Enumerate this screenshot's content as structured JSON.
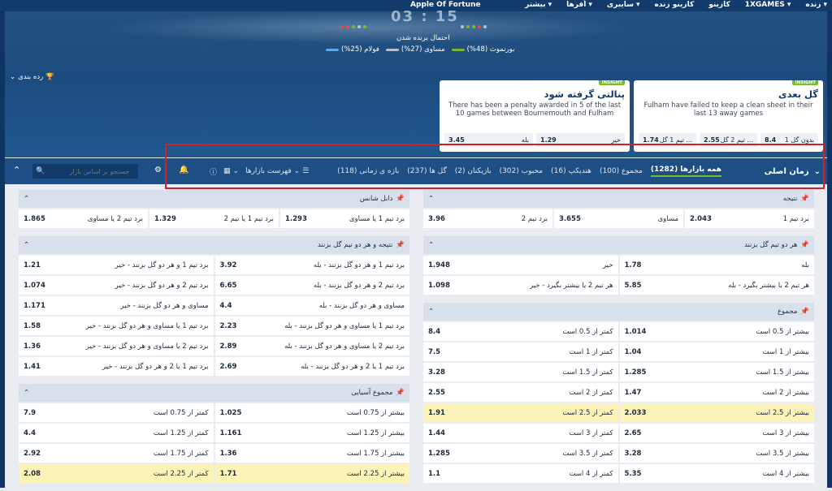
{
  "topnav": {
    "brand": "Apple Of Fortune",
    "items": [
      "زنده",
      "1XGAMES",
      "کازینو",
      "کازینو زنده",
      "سایبری",
      "اُفرها",
      "بیشتر"
    ]
  },
  "hero": {
    "score": "03 : 15",
    "prob_title": "احتمال برنده شدن",
    "bournemouth": "بورنموث (48%)",
    "draw": "مساوی (27%)",
    "fulham": "فولام (25%)",
    "ranking": "رده بندی",
    "colors": {
      "green": "#7bb92f",
      "grey": "#b8c2cf",
      "blue": "#5da8e6"
    }
  },
  "insights": [
    {
      "tag": "INSIGHT",
      "title": "گل بعدی",
      "desc": "Fulham have failed to keep a clean sheet in their last 13 away games",
      "odds": [
        {
          "label": "تیم 1 گل ...",
          "val": "1.74"
        },
        {
          "label": "تیم 2 گل ...",
          "val": "2.55"
        },
        {
          "label": "بدون گل 1",
          "val": "8.4"
        }
      ]
    },
    {
      "tag": "INSIGHT",
      "title": "پنالتی گرفته شود",
      "desc": "There has been a penalty awarded in 5 of the last 10 games between Bournemouth and Fulham",
      "odds": [
        {
          "label": "بله",
          "val": "3.45"
        },
        {
          "label": "خیر",
          "val": "1.29"
        }
      ]
    }
  ],
  "filter": {
    "main": "زمان اصلی",
    "cats": [
      {
        "label": "همه بازارها (1282)"
      },
      {
        "label": "مجموع (100)"
      },
      {
        "label": "هندیکپ (16)"
      },
      {
        "label": "محبوب (302)"
      },
      {
        "label": "بازیکنان (2)"
      },
      {
        "label": "گل ها (237)"
      },
      {
        "label": "بازه ی زمانی (118)"
      }
    ],
    "list_label": "فهرست بازارها",
    "search_placeholder": "جستجو بر اساس بازار"
  },
  "markets": {
    "result": {
      "title": "نتیجه",
      "cells": [
        {
          "l": "برد تیم 1",
          "o": "2.043"
        },
        {
          "l": "مساوی",
          "o": "3.655"
        },
        {
          "l": "برد تیم 2",
          "o": "3.96"
        }
      ]
    },
    "btts": {
      "title": "هر دو تیم گل بزنند",
      "cells": [
        {
          "l": "بله",
          "o": "1.78"
        },
        {
          "l": "خیر",
          "o": "1.948"
        },
        {
          "l": "هر تیم 2 یا بیشتر بگیرد - بله",
          "o": "5.85"
        },
        {
          "l": "هر تیم 2 یا بیشتر بگیرد - خیر",
          "o": "1.098"
        }
      ]
    },
    "total": {
      "title": "مجموع",
      "cells": [
        {
          "l": "بیشتر از 0.5 است",
          "o": "1.014"
        },
        {
          "l": "کمتر از 0.5 است",
          "o": "8.4"
        },
        {
          "l": "بیشتر از 1 است",
          "o": "1.04"
        },
        {
          "l": "کمتر از 1 است",
          "o": "7.5"
        },
        {
          "l": "بیشتر از 1.5 است",
          "o": "1.285"
        },
        {
          "l": "کمتر از 1.5 است",
          "o": "3.28"
        },
        {
          "l": "بیشتر از 2 است",
          "o": "1.47"
        },
        {
          "l": "کمتر از 2 است",
          "o": "2.55"
        },
        {
          "l": "بیشتر از 2.5 است",
          "o": "2.033",
          "hl": true
        },
        {
          "l": "کمتر از 2.5 است",
          "o": "1.91",
          "hl": true
        },
        {
          "l": "بیشتر از 3 است",
          "o": "2.65"
        },
        {
          "l": "کمتر از 3 است",
          "o": "1.44"
        },
        {
          "l": "بیشتر از 3.5 است",
          "o": "3.28"
        },
        {
          "l": "کمتر از 3.5 است",
          "o": "1.285"
        },
        {
          "l": "بیشتر از 4 است",
          "o": "5.35"
        },
        {
          "l": "کمتر از 4 است",
          "o": "1.1"
        }
      ]
    },
    "double": {
      "title": "دابل شانس",
      "cells": [
        {
          "l": "برد تیم 1 یا مساوی",
          "o": "1.293"
        },
        {
          "l": "برد تیم 1 یا تیم 2",
          "o": "1.329"
        },
        {
          "l": "برد تیم 2 یا مساوی",
          "o": "1.865"
        }
      ]
    },
    "result_btts": {
      "title": "نتیجه و هر دو تیم گل بزنند",
      "cells": [
        {
          "l": "برد تیم 1 و هر دو گل بزنند - بله",
          "o": "3.92"
        },
        {
          "l": "برد تیم 1 و هر دو گل بزنند - خیر",
          "o": "1.21"
        },
        {
          "l": "برد تیم 2 و هر دو گل بزنند - بله",
          "o": "6.65"
        },
        {
          "l": "برد تیم 2 و هر دو گل بزنند - خیر",
          "o": "1.074"
        },
        {
          "l": "مساوی و هر دو گل بزنند - بله",
          "o": "4.4"
        },
        {
          "l": "مساوی و هر دو گل بزنند - خیر",
          "o": "1.171"
        },
        {
          "l": "برد تیم 1 یا مساوی و هر دو گل بزنند - بله",
          "o": "2.23"
        },
        {
          "l": "برد تیم 1 یا مساوی و هر دو گل بزنند - خیر",
          "o": "1.58"
        },
        {
          "l": "برد تیم 2 یا مساوی و هر دو گل بزنند - بله",
          "o": "2.89"
        },
        {
          "l": "برد تیم 2 یا مساوی و هر دو گل بزنند - خیر",
          "o": "1.36"
        },
        {
          "l": "برد تیم 1 یا 2 و هر دو گل بزنند - بله",
          "o": "2.69"
        },
        {
          "l": "برد تیم 1 یا 2 و هر دو گل بزنند - خیر",
          "o": "1.41"
        }
      ]
    },
    "asian": {
      "title": "مجموع آسیایی",
      "cells": [
        {
          "l": "بیشتر از 0.75 است",
          "o": "1.025"
        },
        {
          "l": "کمتر از 0.75 است",
          "o": "7.9"
        },
        {
          "l": "بیشتر از 1.25 است",
          "o": "1.161"
        },
        {
          "l": "کمتر از 1.25 است",
          "o": "4.4"
        },
        {
          "l": "بیشتر از 1.75 است",
          "o": "1.36"
        },
        {
          "l": "کمتر از 1.75 است",
          "o": "2.92"
        },
        {
          "l": "بیشتر از 2.25 است",
          "o": "1.71",
          "hl": true
        },
        {
          "l": "کمتر از 2.25 است",
          "o": "2.08",
          "hl": true
        }
      ]
    }
  }
}
